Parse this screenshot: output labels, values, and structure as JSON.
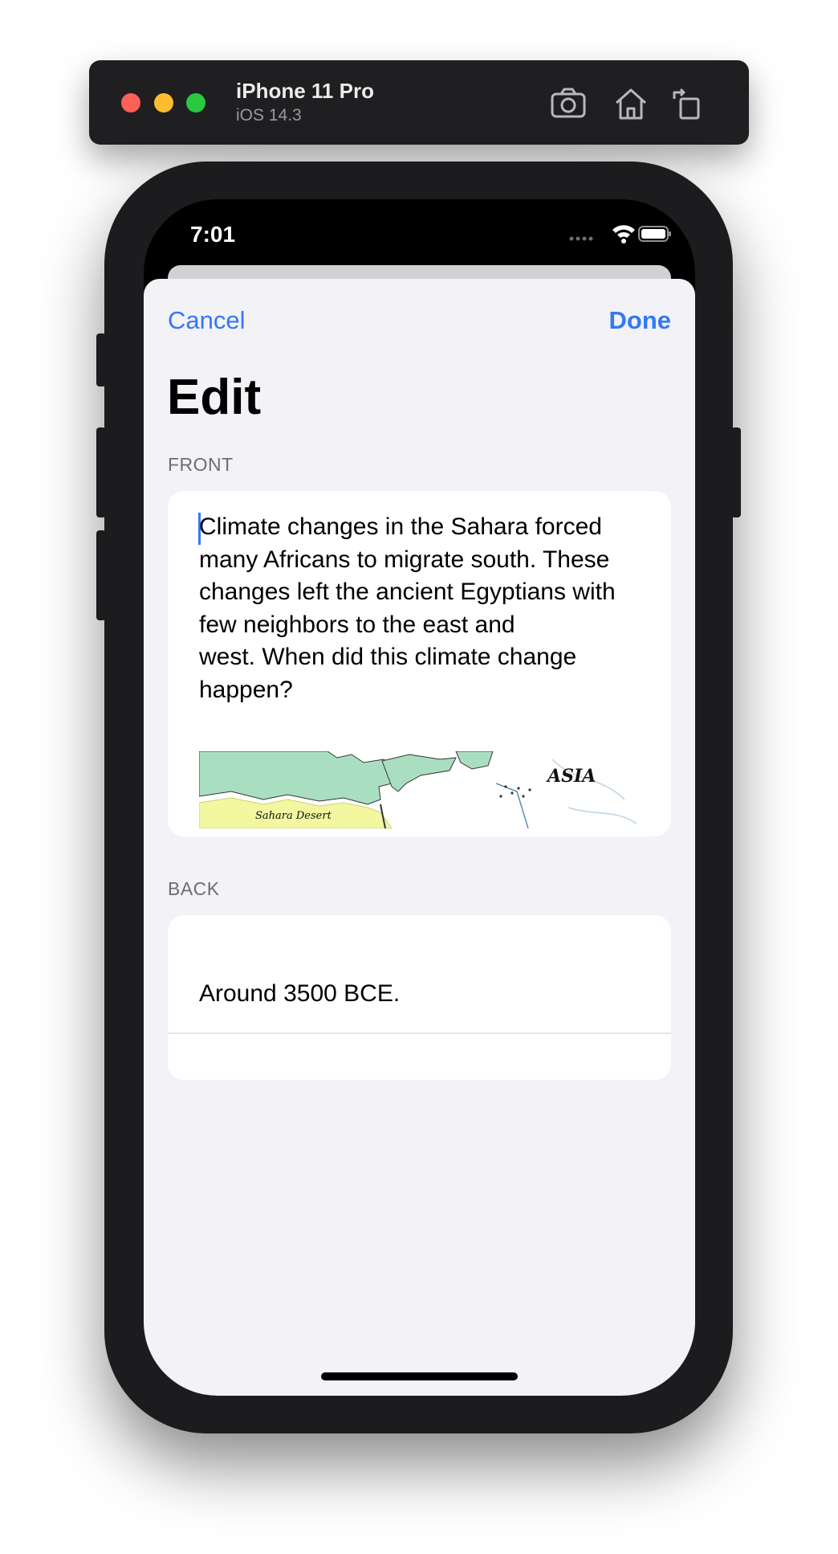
{
  "simulator": {
    "device": "iPhone 11 Pro",
    "os": "iOS 14.3",
    "toolbar_icons": [
      "screenshot-icon",
      "home-icon",
      "rotate-icon"
    ]
  },
  "status_bar": {
    "time": "7:01",
    "icons": [
      "cellular-icon",
      "wifi-icon",
      "battery-icon"
    ]
  },
  "nav": {
    "cancel_label": "Cancel",
    "done_label": "Done"
  },
  "title": "Edit",
  "front": {
    "label": "FRONT",
    "text": "Climate changes in the Sahara forced\nmany Africans to migrate south.  These\nchanges left the ancient Egyptians with\nfew neighbors to the east and\nwest.  When did this climate change\nhappen?",
    "image": {
      "labels": [
        "ASIA",
        "Sahara Desert"
      ]
    }
  },
  "back": {
    "label": "BACK",
    "text": "Around 3500 BCE."
  },
  "colors": {
    "accent": "#3478f6",
    "background": "#f2f2f7",
    "card": "#ffffff",
    "map_land": "#a9dfc0",
    "map_desert": "#f2f7a0"
  }
}
